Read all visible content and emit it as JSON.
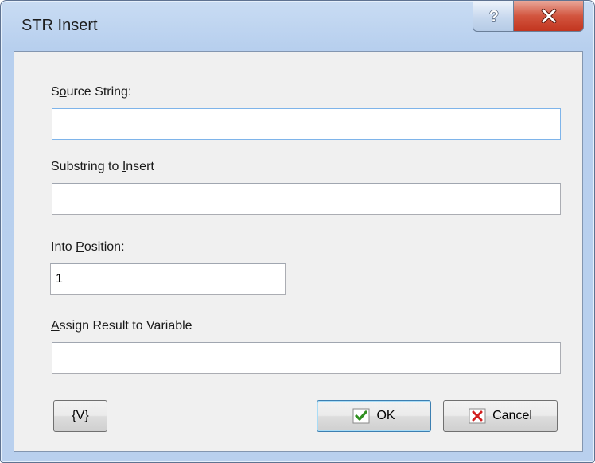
{
  "window": {
    "title": "STR Insert",
    "help_glyph": "?",
    "close_glyph": "x"
  },
  "form": {
    "source_label_pre": "S",
    "source_label_accel": "o",
    "source_label_post": "urce String:",
    "source_value": "",
    "substring_label_pre": "Substring to ",
    "substring_label_accel": "I",
    "substring_label_post": "nsert",
    "substring_value": "",
    "position_label_pre": "Into ",
    "position_label_accel": "P",
    "position_label_post": "osition:",
    "position_value": "1",
    "assign_label_pre": "",
    "assign_label_accel": "A",
    "assign_label_post": "ssign Result to Variable",
    "assign_value": ""
  },
  "buttons": {
    "variables_label": "{V}",
    "ok_label": "OK",
    "cancel_label": "Cancel"
  },
  "icons": {
    "help": "question-mark-icon",
    "close": "close-x-icon",
    "ok": "green-check-icon",
    "cancel": "red-x-icon"
  }
}
